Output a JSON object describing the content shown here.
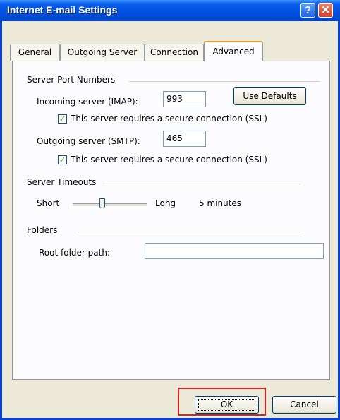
{
  "window": {
    "title": "Internet E-mail Settings",
    "help_glyph": "?",
    "close_glyph": "✕"
  },
  "tabs": [
    {
      "label": "General"
    },
    {
      "label": "Outgoing Server"
    },
    {
      "label": "Connection"
    },
    {
      "label": "Advanced",
      "selected": true
    }
  ],
  "server_ports": {
    "group_label": "Server Port Numbers",
    "incoming_label": "Incoming server (IMAP):",
    "incoming_value": "993",
    "incoming_ssl_label": "This server requires a secure connection (SSL)",
    "incoming_ssl_checked": true,
    "use_defaults_label": "Use Defaults",
    "outgoing_label": "Outgoing server (SMTP):",
    "outgoing_value": "465",
    "outgoing_ssl_label": "This server requires a secure connection (SSL)",
    "outgoing_ssl_checked": true
  },
  "timeouts": {
    "group_label": "Server Timeouts",
    "short_label": "Short",
    "long_label": "Long",
    "value_label": "5 minutes",
    "slider_level": 0.4
  },
  "folders": {
    "group_label": "Folders",
    "root_label": "Root folder path:",
    "root_value": ""
  },
  "footer": {
    "ok_label": "OK",
    "cancel_label": "Cancel"
  },
  "colors": {
    "title_bar": "#0054e3",
    "highlight": "#e02020",
    "tab_accent": "#e8a13a"
  }
}
